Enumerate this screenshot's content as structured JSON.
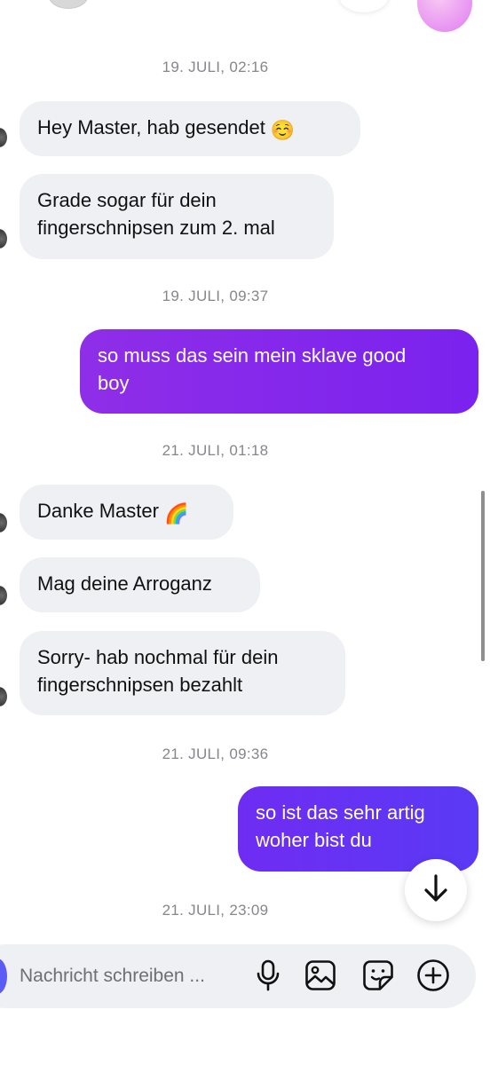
{
  "colors": {
    "incoming_bubble": "#eff0f4",
    "outgoing_gradient_1": [
      "#8f2ee8",
      "#7a22ee"
    ],
    "outgoing_gradient_2": [
      "#6f2cf2",
      "#5a3af5"
    ],
    "timestamp": "#86868d",
    "accent": "#5b5bf5"
  },
  "messages": [
    {
      "type": "timestamp",
      "text": "19. JULI, 02:16"
    },
    {
      "type": "incoming",
      "text": "Hey Master, hab gesendet",
      "emoji": "☺️"
    },
    {
      "type": "incoming",
      "text": "Grade sogar für dein\nfingerschnipsen zum 2. mal"
    },
    {
      "type": "timestamp",
      "text": "19. JULI, 09:37"
    },
    {
      "type": "outgoing",
      "text": "so muss das sein mein sklave good\nboy"
    },
    {
      "type": "timestamp",
      "text": "21. JULI, 01:18"
    },
    {
      "type": "incoming",
      "text": "Danke Master",
      "emoji": "🌈"
    },
    {
      "type": "incoming",
      "text": "Mag deine Arroganz"
    },
    {
      "type": "incoming",
      "text": "Sorry- hab nochmal für dein\nfingerschnipsen bezahlt"
    },
    {
      "type": "timestamp",
      "text": "21. JULI, 09:36"
    },
    {
      "type": "outgoing",
      "text": "so ist das sehr artig\nwoher bist du"
    },
    {
      "type": "timestamp",
      "text": "21. JULI, 23:09"
    }
  ],
  "composer": {
    "placeholder": "Nachricht schreiben ...",
    "icons": [
      "microphone-icon",
      "image-icon",
      "sticker-icon",
      "plus-circle-icon"
    ]
  },
  "scroll_button_icon": "arrow-down-icon"
}
